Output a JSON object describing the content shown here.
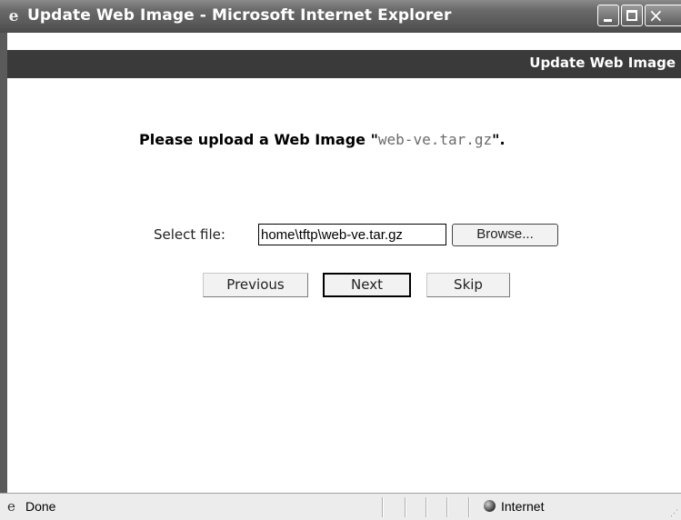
{
  "window": {
    "title": "Update Web Image - Microsoft Internet Explorer",
    "icon": "ie-page-icon",
    "controls": {
      "minimize": "minimize-icon",
      "maximize": "maximize-icon",
      "close": "close-icon",
      "close_glyph": "×"
    }
  },
  "header": {
    "title": "Update Web Image"
  },
  "main": {
    "prompt_prefix": "Please upload a Web Image \"",
    "prompt_filename": "web-ve.tar.gz",
    "prompt_suffix": "\".",
    "file_label": "Select file:",
    "file_value": "home\\tftp\\web-ve.tar.gz",
    "browse_label": "Browse...",
    "buttons": {
      "previous": "Previous",
      "next": "Next",
      "skip": "Skip"
    }
  },
  "status": {
    "text": "Done",
    "zone": "Internet"
  },
  "colors": {
    "titlebar": "#5a5a5a",
    "header_band": "#3a3a3a",
    "filename_accent": "#6a6a6a"
  }
}
